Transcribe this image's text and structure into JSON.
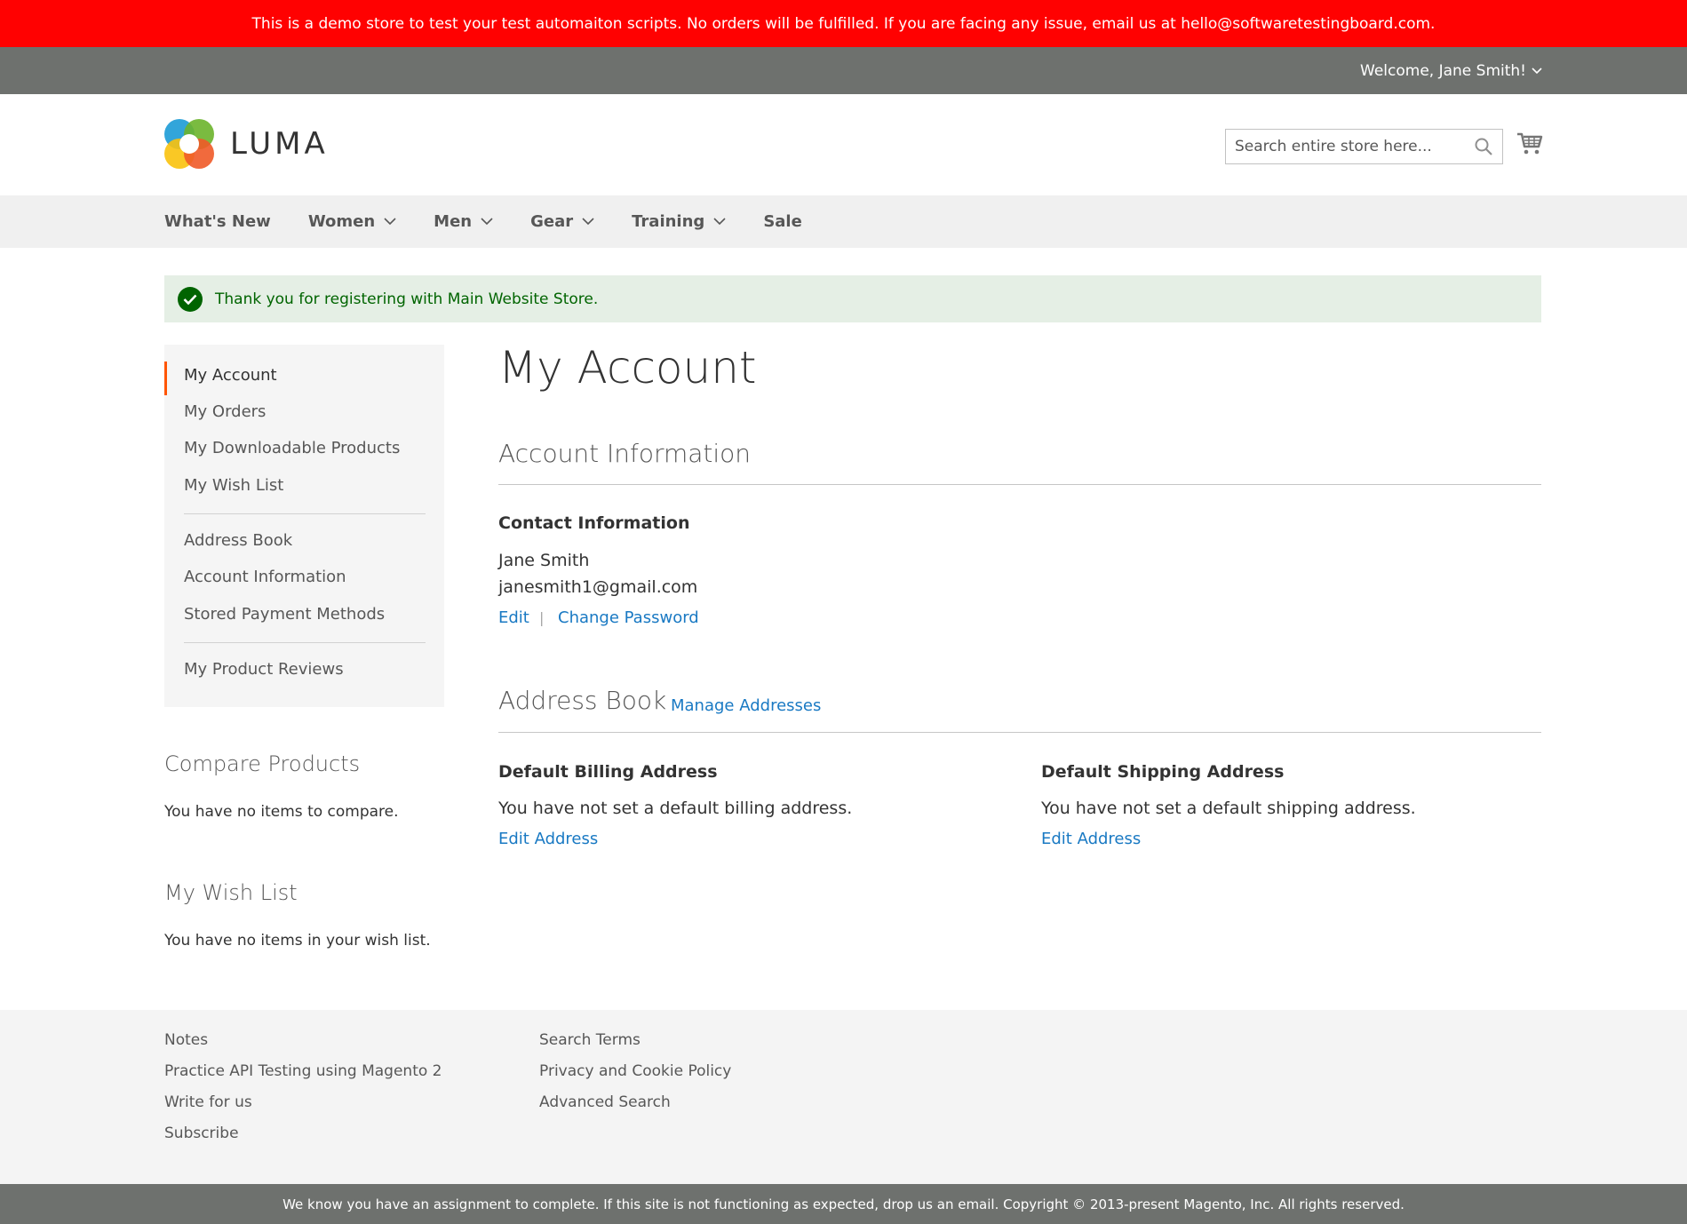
{
  "banner": "This is a demo store to test your test automaiton scripts. No orders will be fulfilled. If you are facing any issue, email us at hello@softwaretestingboard.com.",
  "header": {
    "welcome": "Welcome, Jane Smith!",
    "logo_text": "LUMA",
    "search_placeholder": "Search entire store here..."
  },
  "nav": [
    "What's New",
    "Women",
    "Men",
    "Gear",
    "Training",
    "Sale"
  ],
  "message": "Thank you for registering with Main Website Store.",
  "sidebar": {
    "items": [
      "My Account",
      "My Orders",
      "My Downloadable Products",
      "My Wish List",
      "Address Book",
      "Account Information",
      "Stored Payment Methods",
      "My Product Reviews"
    ],
    "compare_title": "Compare Products",
    "compare_text": "You have no items to compare.",
    "wishlist_title": "My Wish List",
    "wishlist_text": "You have no items in your wish list."
  },
  "main": {
    "page_title": "My Account",
    "account_info_title": "Account Information",
    "contact_title": "Contact Information",
    "name": "Jane Smith",
    "email": "janesmith1@gmail.com",
    "edit": "Edit",
    "separator": "|",
    "change_password": "Change Password",
    "address_book_title": "Address Book",
    "manage_addresses": "Manage Addresses",
    "billing_title": "Default Billing Address",
    "billing_text": "You have not set a default billing address.",
    "shipping_title": "Default Shipping Address",
    "shipping_text": "You have not set a default shipping address.",
    "edit_address": "Edit Address"
  },
  "footer": {
    "col1": [
      "Notes",
      "Practice API Testing using Magento 2",
      "Write for us",
      "Subscribe"
    ],
    "col2": [
      "Search Terms",
      "Privacy and Cookie Policy",
      "Advanced Search"
    ],
    "copyright": "We know you have an assignment to complete. If this site is not functioning as expected, drop us an email. Copyright © 2013-present Magento, Inc. All rights reserved."
  }
}
